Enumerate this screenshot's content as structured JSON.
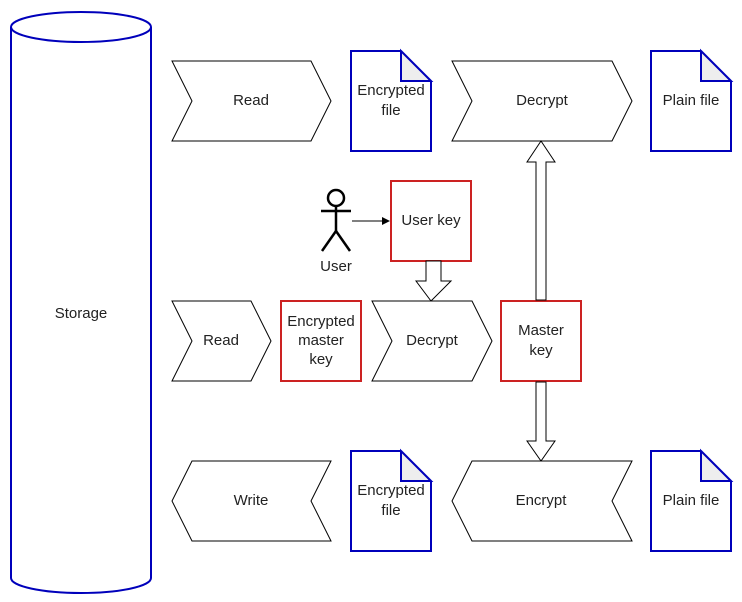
{
  "storage": {
    "label": "Storage"
  },
  "row_read_file": {
    "read": "Read",
    "encrypted_file": [
      "Encrypted",
      "file"
    ],
    "decrypt": "Decrypt",
    "plain_file": "Plain file"
  },
  "user": {
    "label": "User",
    "user_key": "User key"
  },
  "row_master_key": {
    "read": "Read",
    "encrypted_master_key": [
      "Encrypted",
      "master",
      "key"
    ],
    "decrypt": "Decrypt",
    "master_key": [
      "Master",
      "key"
    ]
  },
  "row_write_file": {
    "write": "Write",
    "encrypted_file": [
      "Encrypted",
      "file"
    ],
    "encrypt": "Encrypt",
    "plain_file": "Plain file"
  },
  "colors": {
    "document_border": "#0000bb",
    "key_border": "#cc2222"
  }
}
